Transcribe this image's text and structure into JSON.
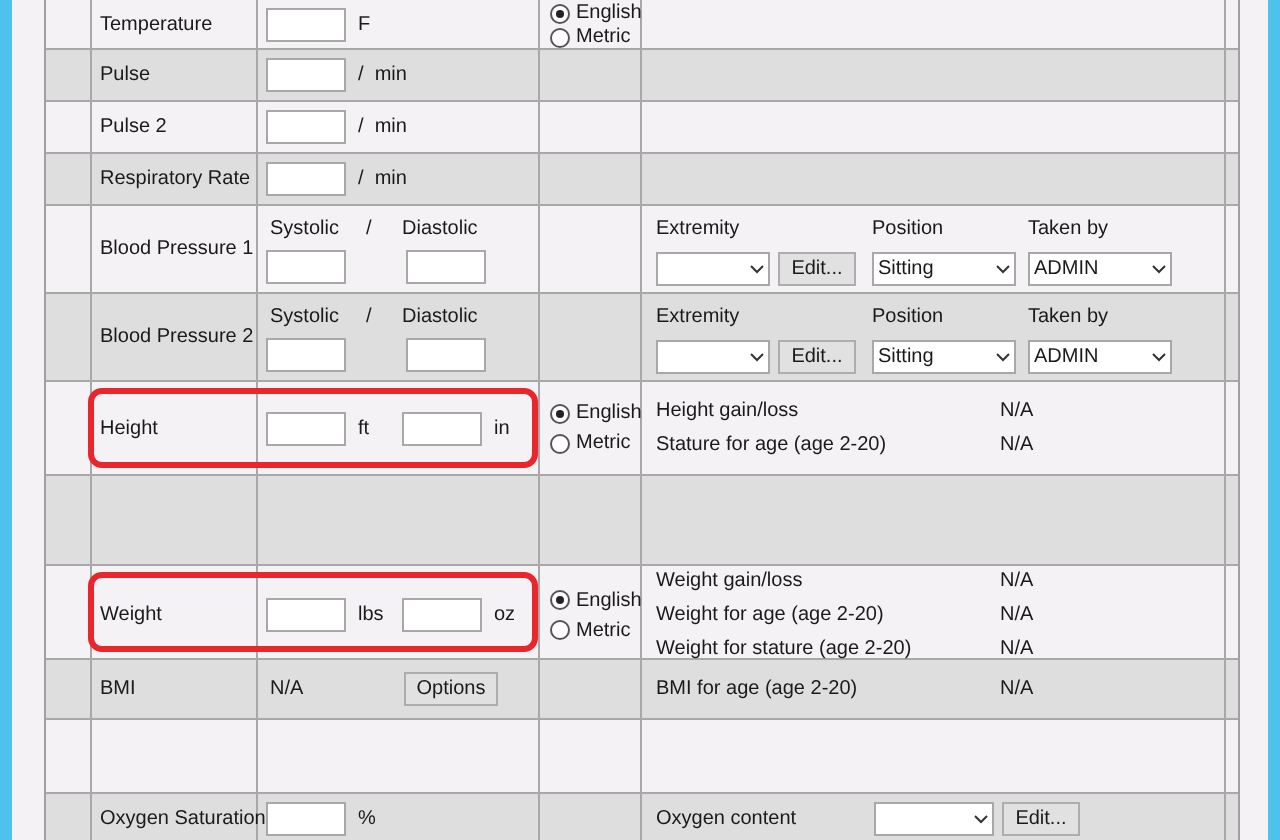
{
  "rows": [
    {
      "kind": "measure",
      "label": "Temperature",
      "highlighted": false,
      "inputs": [
        {
          "unit": "F"
        }
      ],
      "units": [
        {
          "label": "English",
          "selected": true
        },
        {
          "label": "Metric",
          "selected": false
        }
      ]
    },
    {
      "kind": "measure",
      "label": "Pulse",
      "highlighted": false,
      "inputs": [
        {
          "unit": "/  min"
        }
      ]
    },
    {
      "kind": "measure",
      "label": "Pulse 2",
      "highlighted": false,
      "inputs": [
        {
          "unit": "/  min"
        }
      ]
    },
    {
      "kind": "measure",
      "label": "Respiratory Rate",
      "highlighted": false,
      "inputs": [
        {
          "unit": "/  min"
        }
      ]
    },
    {
      "kind": "pressure",
      "label": "Blood Pressure 1",
      "systolic": "Systolic",
      "separator": "/",
      "diastolic": "Diastolic",
      "details": {
        "kind": "site",
        "extremity_label": "Extremity",
        "edit": "Edit...",
        "position_label": "Position",
        "position": "Sitting",
        "taken_by_label": "Taken by",
        "taken_by": "ADMIN"
      }
    },
    {
      "kind": "pressure",
      "label": "Blood Pressure 2",
      "systolic": "Systolic",
      "separator": "/",
      "diastolic": "Diastolic",
      "details": {
        "kind": "site",
        "extremity_label": "Extremity",
        "edit": "Edit...",
        "position_label": "Position",
        "position": "Sitting",
        "taken_by_label": "Taken by",
        "taken_by": "ADMIN"
      }
    },
    {
      "kind": "measure",
      "label": "Height",
      "highlighted": true,
      "inputs": [
        {
          "unit": "ft"
        },
        {
          "unit": "in"
        }
      ],
      "units": [
        {
          "label": "English",
          "selected": true
        },
        {
          "label": "Metric",
          "selected": false
        }
      ],
      "details": {
        "kind": "results",
        "items": [
          {
            "label": "Height gain/loss",
            "value": "N/A"
          },
          {
            "label": "Stature for age (age 2-20)",
            "value": "N/A"
          }
        ]
      }
    },
    {
      "kind": "blank"
    },
    {
      "kind": "measure",
      "label": "Weight",
      "highlighted": true,
      "inputs": [
        {
          "unit": "lbs"
        },
        {
          "unit": "oz"
        }
      ],
      "units": [
        {
          "label": "English",
          "selected": true
        },
        {
          "label": "Metric",
          "selected": false
        }
      ],
      "details": {
        "kind": "results",
        "items": [
          {
            "label": "Weight gain/loss",
            "value": "N/A"
          },
          {
            "label": "Weight for age (age 2-20)",
            "value": "N/A"
          },
          {
            "label": "Weight for stature (age 2-20)",
            "value": "N/A"
          }
        ]
      }
    },
    {
      "kind": "calculated",
      "label": "BMI",
      "value": "N/A",
      "button": "Options",
      "details": {
        "kind": "results",
        "items": [
          {
            "label": "BMI for age (age 2-20)",
            "value": "N/A"
          }
        ]
      }
    },
    {
      "kind": "blank"
    },
    {
      "kind": "measure",
      "label": "Oxygen Saturation",
      "highlighted": false,
      "inputs": [
        {
          "unit": "%"
        }
      ],
      "details": {
        "kind": "content",
        "label": "Oxygen content",
        "edit": "Edit..."
      }
    }
  ]
}
